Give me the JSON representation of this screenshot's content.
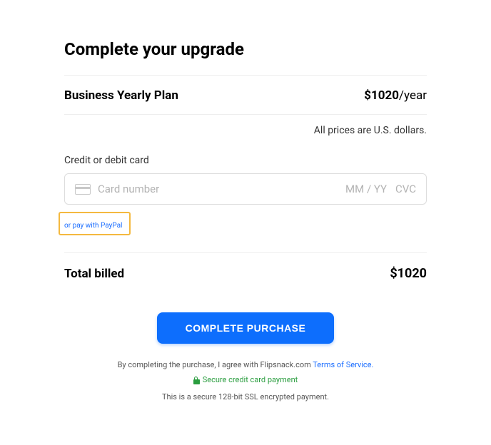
{
  "title": "Complete your upgrade",
  "plan": {
    "name": "Business Yearly Plan",
    "price": "$1020",
    "period": "/year"
  },
  "currency_note": "All prices are U.S. dollars.",
  "card": {
    "label": "Credit or debit card",
    "placeholder_number": "Card number",
    "placeholder_expiry": "MM / YY",
    "placeholder_cvc": "CVC"
  },
  "paypal_link": "or pay with PayPal",
  "total": {
    "label": "Total billed",
    "amount": "$1020"
  },
  "button": "COMPLETE PURCHASE",
  "footer": {
    "agree_prefix": "By completing the purchase, I agree with Flipsnack.com ",
    "tos_link": "Terms of Service.",
    "secure": "Secure credit card payment",
    "ssl": "This is a secure 128-bit SSL encrypted payment."
  }
}
